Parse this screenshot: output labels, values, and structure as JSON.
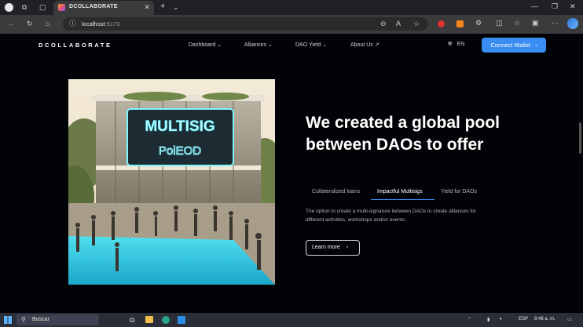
{
  "browser": {
    "tab_title": "DCOLLABORATE",
    "url_host": "localhost",
    "url_port": ":5173"
  },
  "site": {
    "logo": "DCOLLABORATE",
    "nav": [
      {
        "label": "Dashboard",
        "suffix": "⌄"
      },
      {
        "label": "Alliances",
        "suffix": "⌄"
      },
      {
        "label": "DAO Yield",
        "suffix": "⌄"
      },
      {
        "label": "About Us",
        "suffix": "↗"
      }
    ],
    "language": "EN",
    "connect_wallet": "Connect Wallet"
  },
  "hero": {
    "image_sign_line1": "MULTISIG",
    "image_sign_line2": "PoiEOD",
    "headline": "We created a global pool between DAOs to offer",
    "tabs": [
      "Collateralized loans",
      "Impactful Multisigs",
      "Yield for DAOs"
    ],
    "active_tab": 1,
    "description": "The option to create a multi-signature between DAOs to create alliances for different activities, workshops and/or events.",
    "learn_more": "Learn more"
  },
  "taskbar": {
    "search_placeholder": "Buscar",
    "language": "ESP",
    "time": "9:46 a. m."
  },
  "colors": {
    "accent": "#3a8df2",
    "page_bg": "#020306",
    "chrome_bg": "#202124"
  }
}
